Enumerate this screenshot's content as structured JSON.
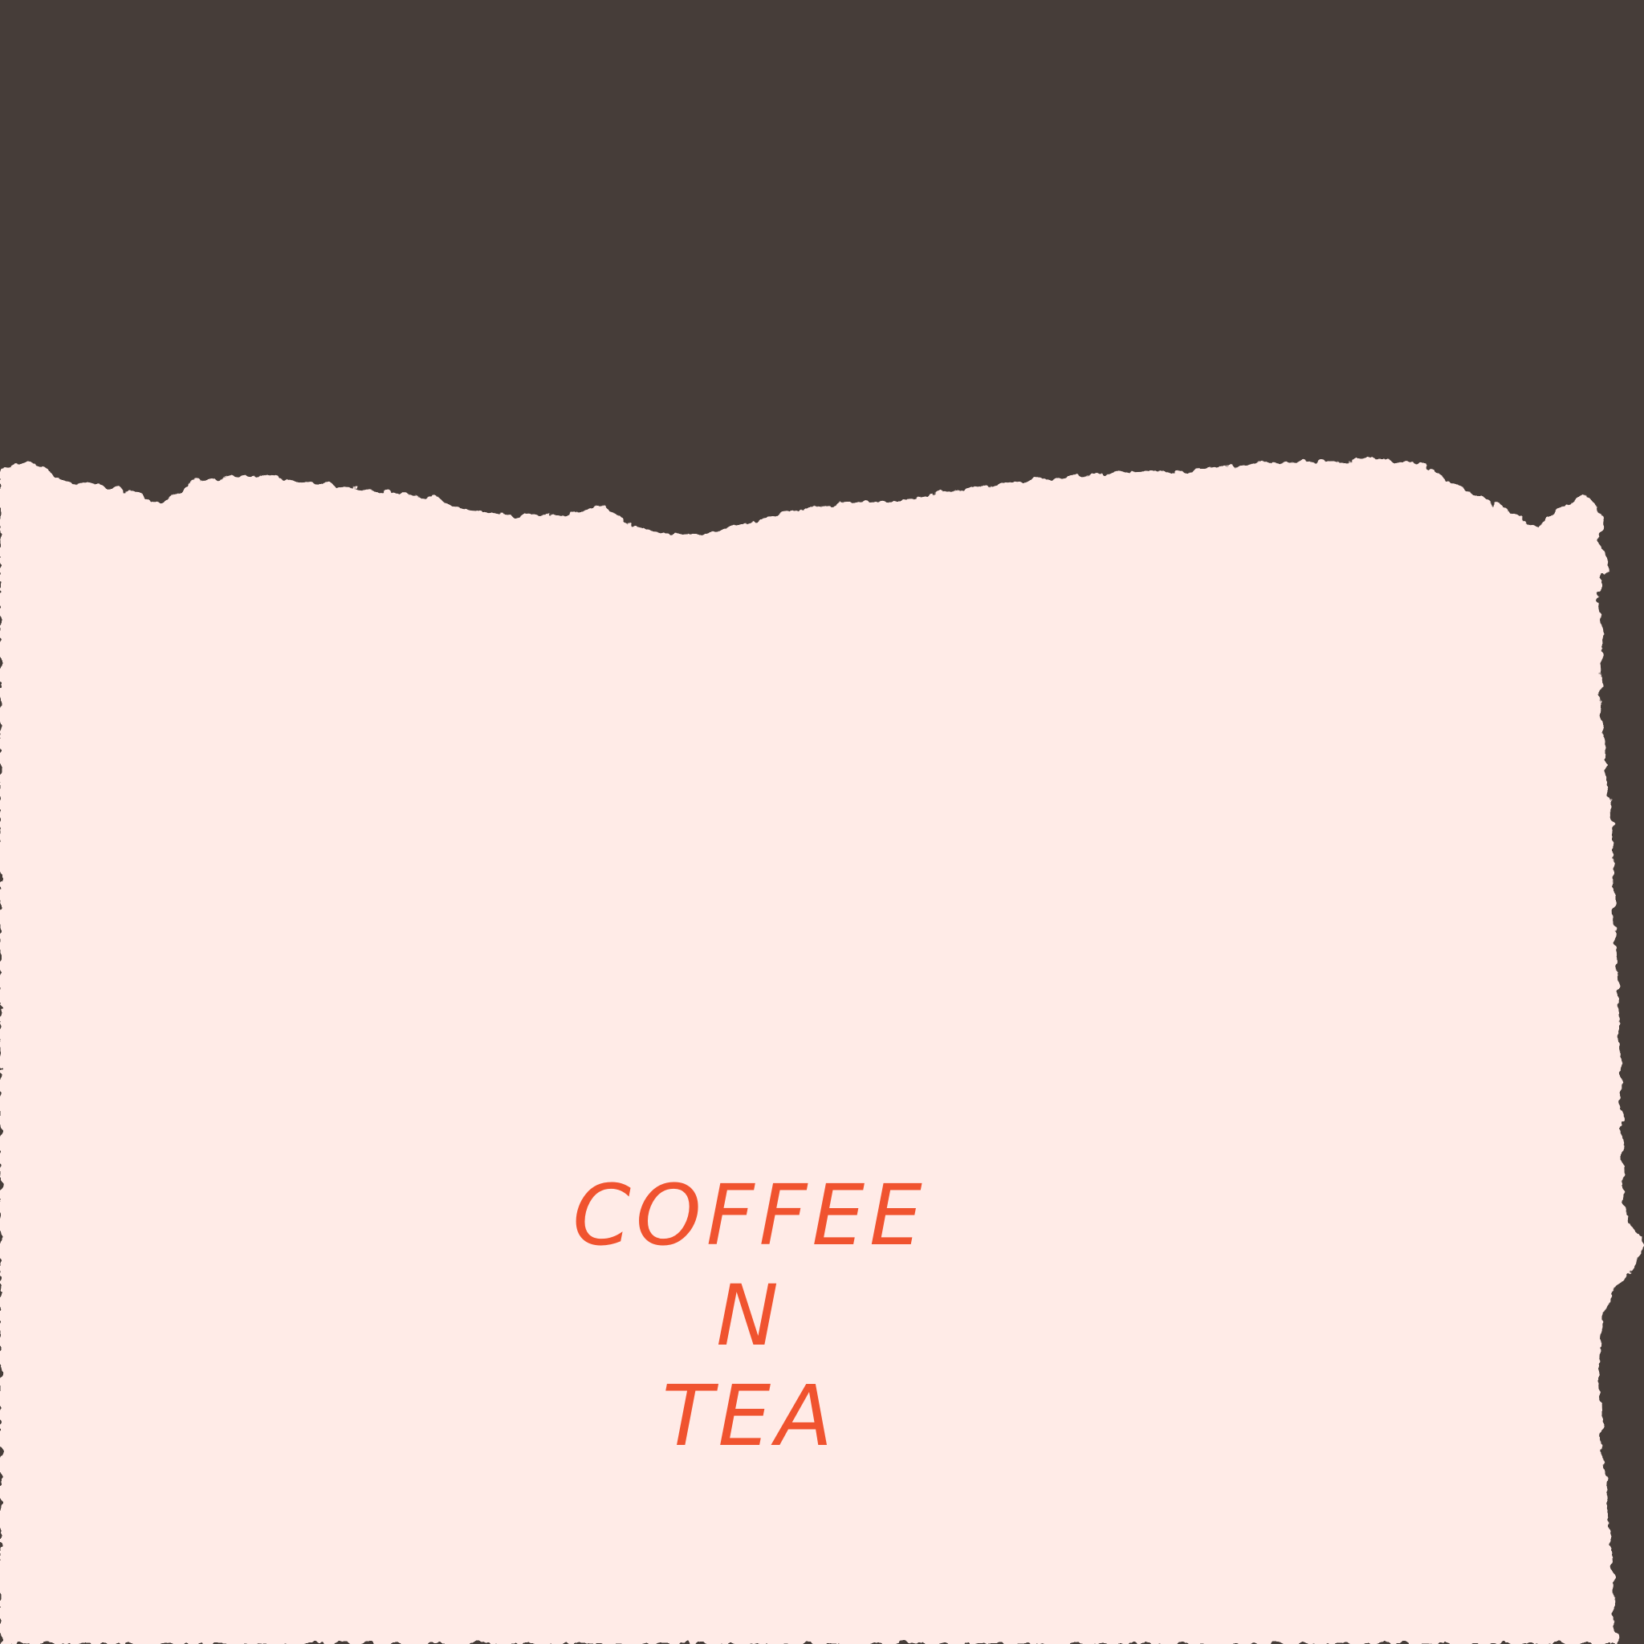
{
  "poster": {
    "title_lines": [
      "COFFEE",
      "N",
      "TEA"
    ]
  },
  "colors": {
    "background_dark": "#463d39",
    "paper": "#ffebe7",
    "text_accent": "#f0532f"
  }
}
